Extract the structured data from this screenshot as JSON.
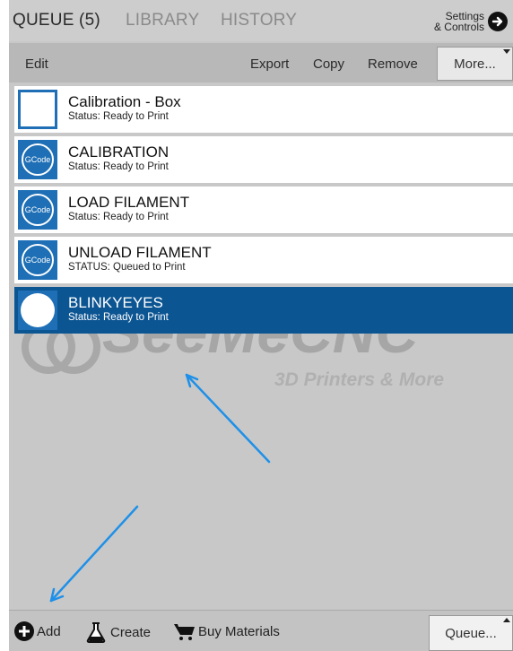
{
  "tabs": {
    "queue": "QUEUE (5)",
    "library": "LIBRARY",
    "history": "HISTORY"
  },
  "settings": {
    "line1": "Settings",
    "line2": "& Controls"
  },
  "toolbar": {
    "edit": "Edit",
    "export": "Export",
    "copy": "Copy",
    "remove": "Remove",
    "more": "More..."
  },
  "queue_items": [
    {
      "title": "Calibration - Box",
      "status": "Status: Ready to Print",
      "thumb": "blank"
    },
    {
      "title": "CALIBRATION",
      "status": "Status: Ready to Print",
      "thumb": "gcode",
      "thumb_label": "GCode"
    },
    {
      "title": "LOAD FILAMENT",
      "status": "Status: Ready to Print",
      "thumb": "gcode",
      "thumb_label": "GCode"
    },
    {
      "title": "UNLOAD FILAMENT",
      "status": "STATUS: Queued to Print",
      "thumb": "gcode",
      "thumb_label": "GCode"
    },
    {
      "title": "BLINKYEYES",
      "status": "Status: Ready to Print",
      "thumb": "circle",
      "selected": true
    }
  ],
  "watermark": {
    "brand": "SeeMeCNC",
    "tagline": "3D Printers & More"
  },
  "bottom": {
    "add": "Add",
    "create": "Create",
    "buy": "Buy Materials",
    "queue": "Queue..."
  },
  "colors": {
    "selected_row": "#0c5593",
    "thumb_blue": "#1e6fb5",
    "annotation_arrow": "#1e90e8"
  }
}
